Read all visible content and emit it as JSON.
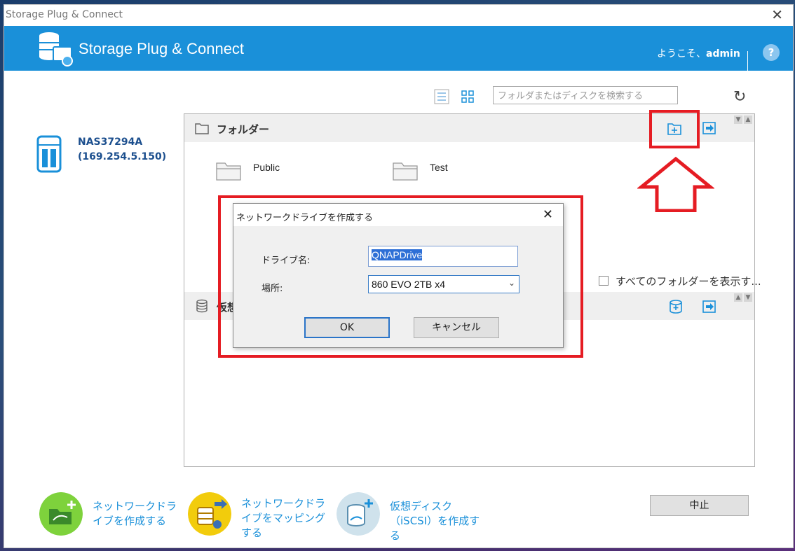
{
  "window": {
    "title": "Storage Plug & Connect",
    "close_glyph": "✕"
  },
  "header": {
    "app_title": "Storage Plug & Connect",
    "welcome": "ようこそ、",
    "user": "admin",
    "help_glyph": "?"
  },
  "toolbar": {
    "search_placeholder": "フォルダまたはディスクを検索する",
    "refresh_glyph": "↻"
  },
  "device": {
    "name": "NAS37294A",
    "ip": "(169.254.5.150)"
  },
  "folders_section": {
    "label": "フォルダー",
    "items": [
      {
        "name": "Public"
      },
      {
        "name": "Test"
      }
    ],
    "show_all_label": "すべてのフォルダーを表示す..."
  },
  "disks_section": {
    "label": "仮想"
  },
  "dialog": {
    "title": "ネットワークドライブを作成する",
    "close_glyph": "✕",
    "drive_name_label": "ドライブ名:",
    "drive_name_value": "QNAPDrive",
    "location_label": "場所:",
    "location_value": "860 EVO 2TB x4",
    "ok_label": "OK",
    "cancel_label": "キャンセル"
  },
  "bottom": {
    "actions": [
      {
        "label": "ネットワークドライブを作成する",
        "color": "#7ed23c"
      },
      {
        "label": "ネットワークドライブをマッピングする",
        "color": "#f2cc0c"
      },
      {
        "label": "仮想ディスク（iSCSI）を作成する",
        "color": "#cfe2ec"
      }
    ],
    "cancel_label": "中止"
  },
  "colors": {
    "header_bg": "#1a90d9",
    "highlight_red": "#e51c23",
    "link_blue": "#1a90d9"
  }
}
